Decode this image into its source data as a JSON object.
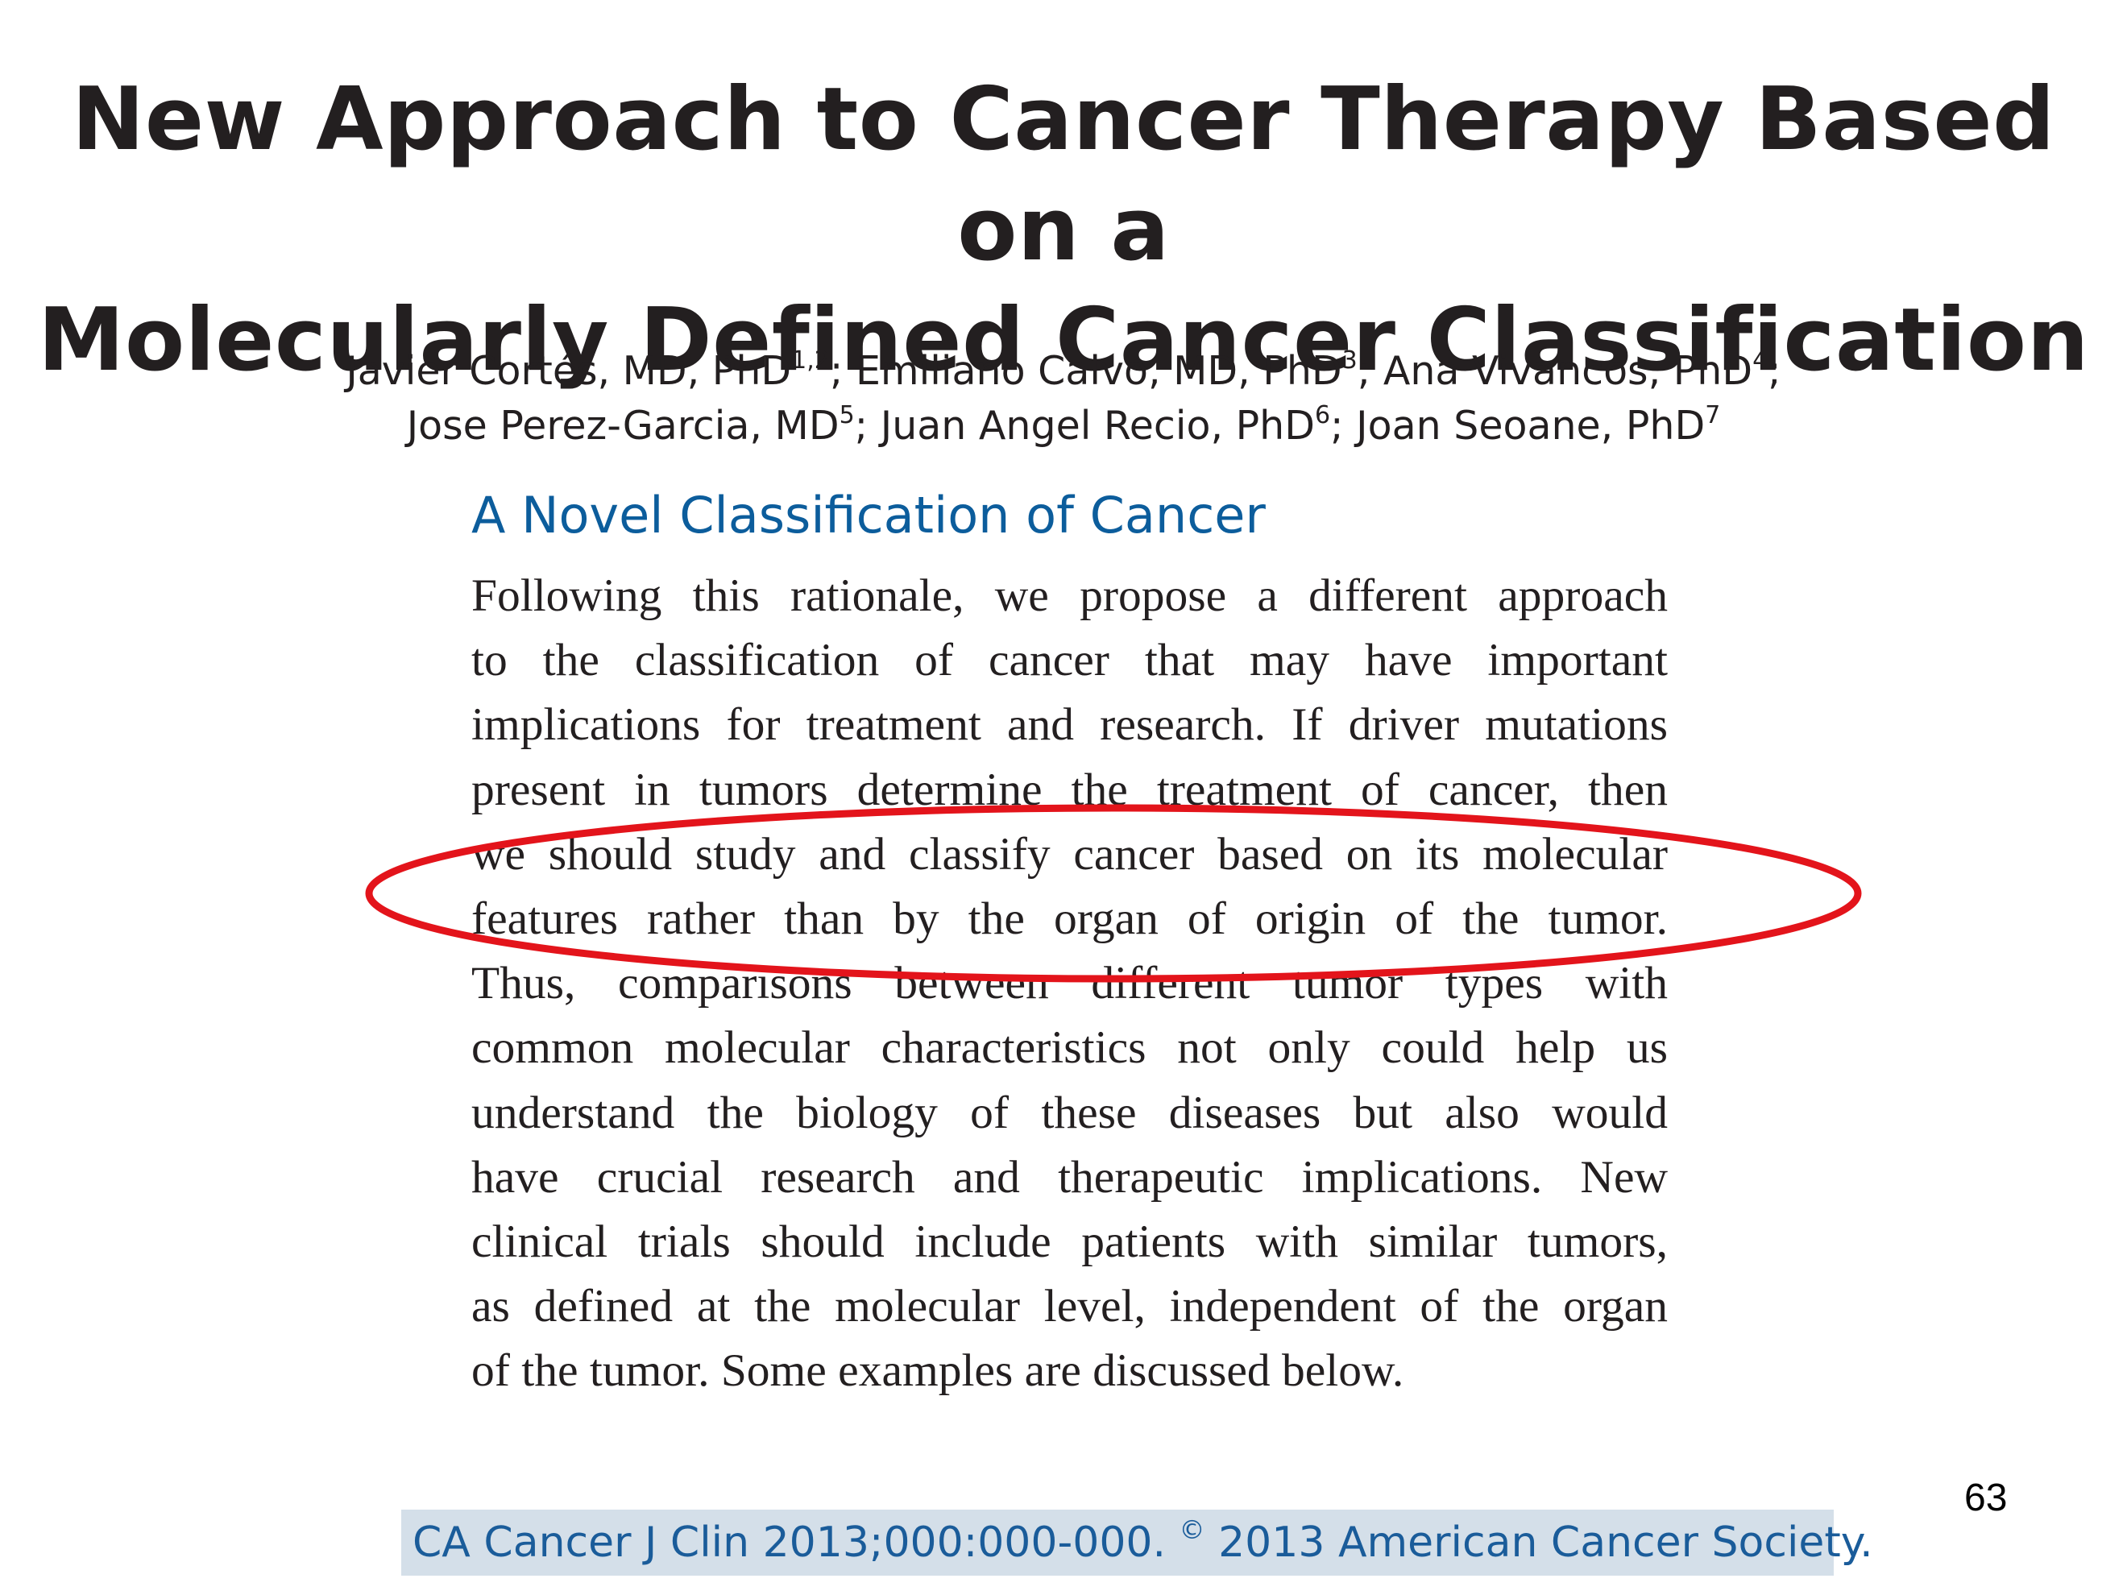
{
  "title": {
    "line1": "New Approach to Cancer Therapy Based on a",
    "line2": "Molecularly Defined Cancer Classification"
  },
  "authors": [
    {
      "name": "Javier Cortés, MD, PhD",
      "sup": "1,2",
      "sep": "; "
    },
    {
      "name": "Emiliano Calvo, MD, PhD",
      "sup": "3",
      "sep": "; "
    },
    {
      "name": "Ana Vivancos, PhD",
      "sup": "4",
      "sep": ";"
    },
    {
      "name": "Jose Perez-Garcia, MD",
      "sup": "5",
      "sep": "; "
    },
    {
      "name": "Juan Angel Recio, PhD",
      "sup": "6",
      "sep": "; "
    },
    {
      "name": "Joan Seoane, PhD",
      "sup": "7",
      "sep": ""
    }
  ],
  "section": {
    "heading": "A Novel Classification of Cancer",
    "lines": [
      "Following this rationale, we propose a different approach",
      "to the classification of cancer that may have important",
      "implications for treatment and research. If driver mutations",
      "present in tumors determine the treatment of cancer, then",
      "we should study and classify cancer based on its molecular",
      "features rather than by the organ of origin of the tumor.",
      "Thus, comparisons between different tumor types with",
      "common molecular characteristics not only could help us",
      "understand the biology of these diseases but also would",
      "have crucial research and therapeutic implications. New",
      "clinical trials should include patients with similar tumors,",
      "as defined at the molecular level, independent of the organ",
      "of the tumor. Some examples are discussed below."
    ]
  },
  "highlight_color": "#e3141b",
  "citation": {
    "journal": "CA Cancer J Clin 2013;000:000-000. ",
    "copyright_symbol": "©",
    "society": " 2013 American Cancer Society."
  },
  "page_number": "63"
}
